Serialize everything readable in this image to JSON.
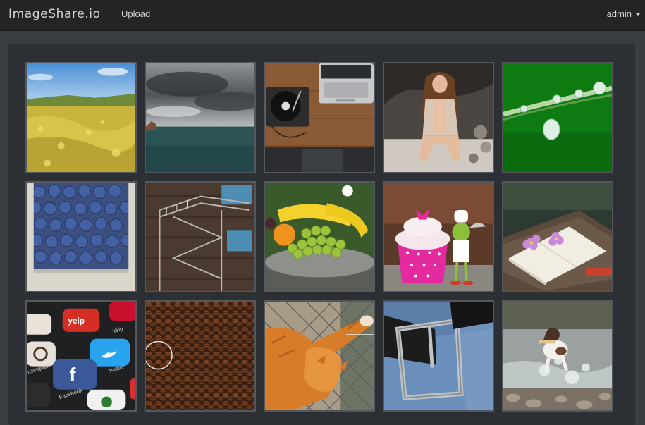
{
  "navbar": {
    "brand": "ImageShare.io",
    "upload_label": "Upload",
    "user_label": "admin"
  },
  "gallery": {
    "images": [
      {
        "subject": "rapeseed-field"
      },
      {
        "subject": "stormy-sea"
      },
      {
        "subject": "turntable-and-laptop"
      },
      {
        "subject": "woman-in-cave"
      },
      {
        "subject": "dewdrops-on-grass"
      },
      {
        "subject": "blueberries"
      },
      {
        "subject": "fire-escape-stairs"
      },
      {
        "subject": "fruit-bowl"
      },
      {
        "subject": "cupcake-and-frog-figurine"
      },
      {
        "subject": "open-book-with-flowers"
      },
      {
        "subject": "social-app-icons"
      },
      {
        "subject": "coffee-beans"
      },
      {
        "subject": "cat-at-fence"
      },
      {
        "subject": "leather-belt-buckle"
      },
      {
        "subject": "dog-running-in-stream"
      }
    ]
  },
  "app_icons": {
    "facebook": "f",
    "instagram": "Instagram",
    "facebook_label": "Facebook",
    "twitter": "Twitter",
    "yelp": "yelp",
    "yelp_label": "Yelp"
  },
  "colors": {
    "navbar_bg": "#222426",
    "page_bg": "#3a3d41",
    "panel_bg": "#2c2f33",
    "tile_border": "#54585d"
  }
}
